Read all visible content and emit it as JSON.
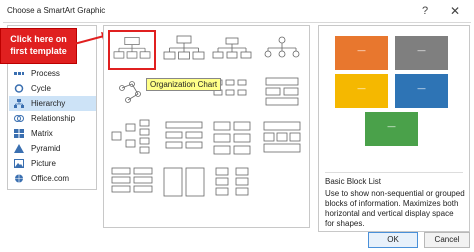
{
  "window": {
    "title": "Choose a SmartArt Graphic",
    "help_glyph": "?",
    "close_glyph": "✕"
  },
  "callout": {
    "text": "Click here on first template"
  },
  "categories": [
    {
      "label": "Process",
      "icon": "process-icon"
    },
    {
      "label": "Cycle",
      "icon": "cycle-icon"
    },
    {
      "label": "Hierarchy",
      "icon": "hierarchy-icon",
      "selected": true
    },
    {
      "label": "Relationship",
      "icon": "relationship-icon"
    },
    {
      "label": "Matrix",
      "icon": "matrix-icon"
    },
    {
      "label": "Pyramid",
      "icon": "pyramid-icon"
    },
    {
      "label": "Picture",
      "icon": "picture-icon"
    },
    {
      "label": "Office.com",
      "icon": "office-com-icon"
    }
  ],
  "gallery": {
    "tooltip": "Organization Chart"
  },
  "preview": {
    "box_text": "—",
    "colors": [
      "#e8772e",
      "#7f7f7f",
      "#f5b800",
      "#2e74b5",
      "#4aa14a"
    ],
    "title": "Basic Block List",
    "description": "Use to show non-sequential or grouped blocks of information. Maximizes both horizontal and vertical display space for shapes."
  },
  "buttons": {
    "ok": "OK",
    "cancel": "Cancel"
  }
}
